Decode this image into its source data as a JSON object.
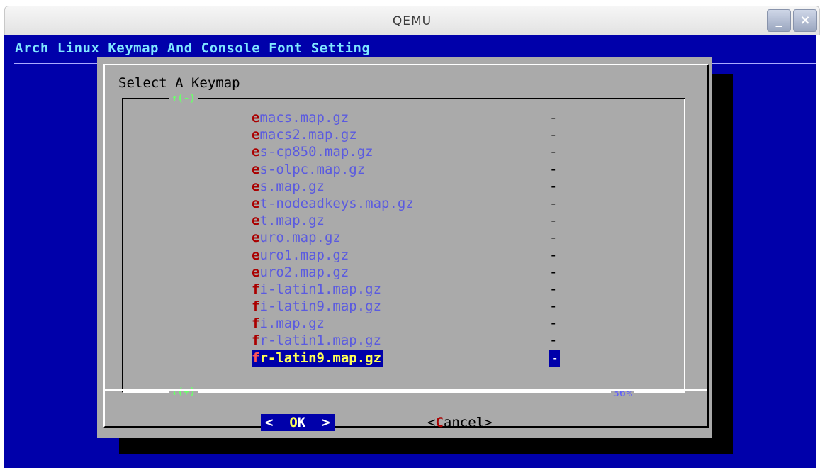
{
  "window": {
    "title": "QEMU",
    "minimize_symbol": "_",
    "close_symbol": "×"
  },
  "console": {
    "backtitle": "Arch Linux Keymap And Console Font Setting",
    "dialog": {
      "title": "Select A Keymap",
      "scroll_up": "↑(-)",
      "scroll_down": "↓(+)",
      "scroll_percent": "36%",
      "items": [
        {
          "hot": "e",
          "rest": "macs.map.gz",
          "tag": "-"
        },
        {
          "hot": "e",
          "rest": "macs2.map.gz",
          "tag": "-"
        },
        {
          "hot": "e",
          "rest": "s-cp850.map.gz",
          "tag": "-"
        },
        {
          "hot": "e",
          "rest": "s-olpc.map.gz",
          "tag": "-"
        },
        {
          "hot": "e",
          "rest": "s.map.gz",
          "tag": "-"
        },
        {
          "hot": "e",
          "rest": "t-nodeadkeys.map.gz",
          "tag": "-"
        },
        {
          "hot": "e",
          "rest": "t.map.gz",
          "tag": "-"
        },
        {
          "hot": "e",
          "rest": "uro.map.gz",
          "tag": "-"
        },
        {
          "hot": "e",
          "rest": "uro1.map.gz",
          "tag": "-"
        },
        {
          "hot": "e",
          "rest": "uro2.map.gz",
          "tag": "-"
        },
        {
          "hot": "f",
          "rest": "i-latin1.map.gz",
          "tag": "-"
        },
        {
          "hot": "f",
          "rest": "i-latin9.map.gz",
          "tag": "-"
        },
        {
          "hot": "f",
          "rest": "i.map.gz",
          "tag": "-"
        },
        {
          "hot": "f",
          "rest": "r-latin1.map.gz",
          "tag": "-"
        },
        {
          "hot": "f",
          "rest": "r-latin9.map.gz",
          "tag": "-",
          "selected": true
        }
      ],
      "ok_button": {
        "left": "<  ",
        "hot": "O",
        "rest": "K",
        "right": "  >"
      },
      "cancel_button": {
        "left": "<",
        "hot": "C",
        "rest": "ancel",
        "right": ">"
      }
    }
  },
  "colors": {
    "screen_bg": "#0000aa",
    "dialog_bg": "#aaaaaa",
    "item_text": "#5a5ae0",
    "hotkey": "#aa0000",
    "selected_text": "#ffff55",
    "arrow_green": "#6cff6c"
  }
}
